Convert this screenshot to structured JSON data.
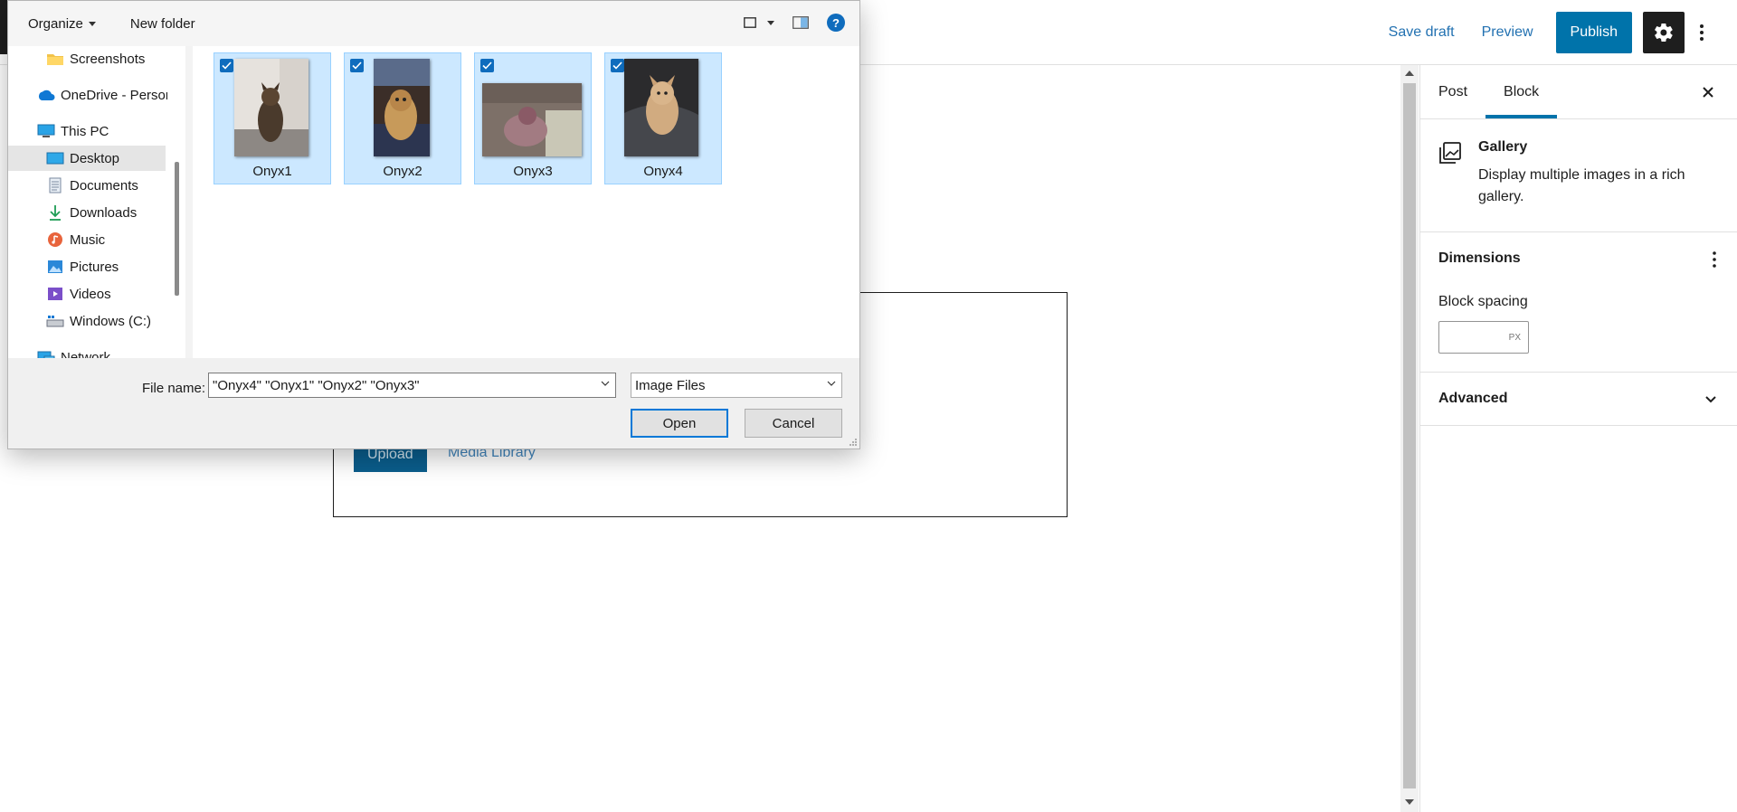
{
  "editor": {
    "save_draft": "Save draft",
    "preview": "Preview",
    "publish": "Publish",
    "accent_color": "#0073aa"
  },
  "canvas": {
    "upload_label": "Upload",
    "media_library_label": "Media Library"
  },
  "sidebar": {
    "tabs": [
      {
        "label": "Post",
        "active": false
      },
      {
        "label": "Block",
        "active": true
      }
    ],
    "block": {
      "icon": "gallery-icon",
      "title": "Gallery",
      "description": "Display multiple images in a rich gallery."
    },
    "dimensions": {
      "title": "Dimensions",
      "block_spacing_label": "Block spacing",
      "block_spacing_value": "",
      "unit": "PX"
    },
    "advanced": {
      "title": "Advanced"
    }
  },
  "dialog": {
    "toolbar": {
      "organize": "Organize",
      "new_folder": "New folder",
      "help": "?"
    },
    "nav": [
      {
        "label": "Screenshots",
        "icon": "folder-icon",
        "selected": false
      },
      {
        "label": "OneDrive - Personal",
        "icon": "onedrive-icon",
        "selected": false
      },
      {
        "label": "This PC",
        "icon": "computer-icon",
        "selected": false
      },
      {
        "label": "Desktop",
        "icon": "desktop-icon",
        "selected": true
      },
      {
        "label": "Documents",
        "icon": "documents-icon",
        "selected": false
      },
      {
        "label": "Downloads",
        "icon": "download-icon",
        "selected": false
      },
      {
        "label": "Music",
        "icon": "music-icon",
        "selected": false
      },
      {
        "label": "Pictures",
        "icon": "pictures-icon",
        "selected": false
      },
      {
        "label": "Videos",
        "icon": "videos-icon",
        "selected": false
      },
      {
        "label": "Windows (C:)",
        "icon": "drive-icon",
        "selected": false
      },
      {
        "label": "Network",
        "icon": "network-icon",
        "selected": false
      }
    ],
    "files": [
      {
        "name": "Onyx1",
        "selected": true
      },
      {
        "name": "Onyx2",
        "selected": true
      },
      {
        "name": "Onyx3",
        "selected": true
      },
      {
        "name": "Onyx4",
        "selected": true
      }
    ],
    "file_name_label": "File name:",
    "file_name_value": "\"Onyx4\" \"Onyx1\" \"Onyx2\" \"Onyx3\"",
    "file_type": "Image Files",
    "open_label": "Open",
    "cancel_label": "Cancel"
  }
}
